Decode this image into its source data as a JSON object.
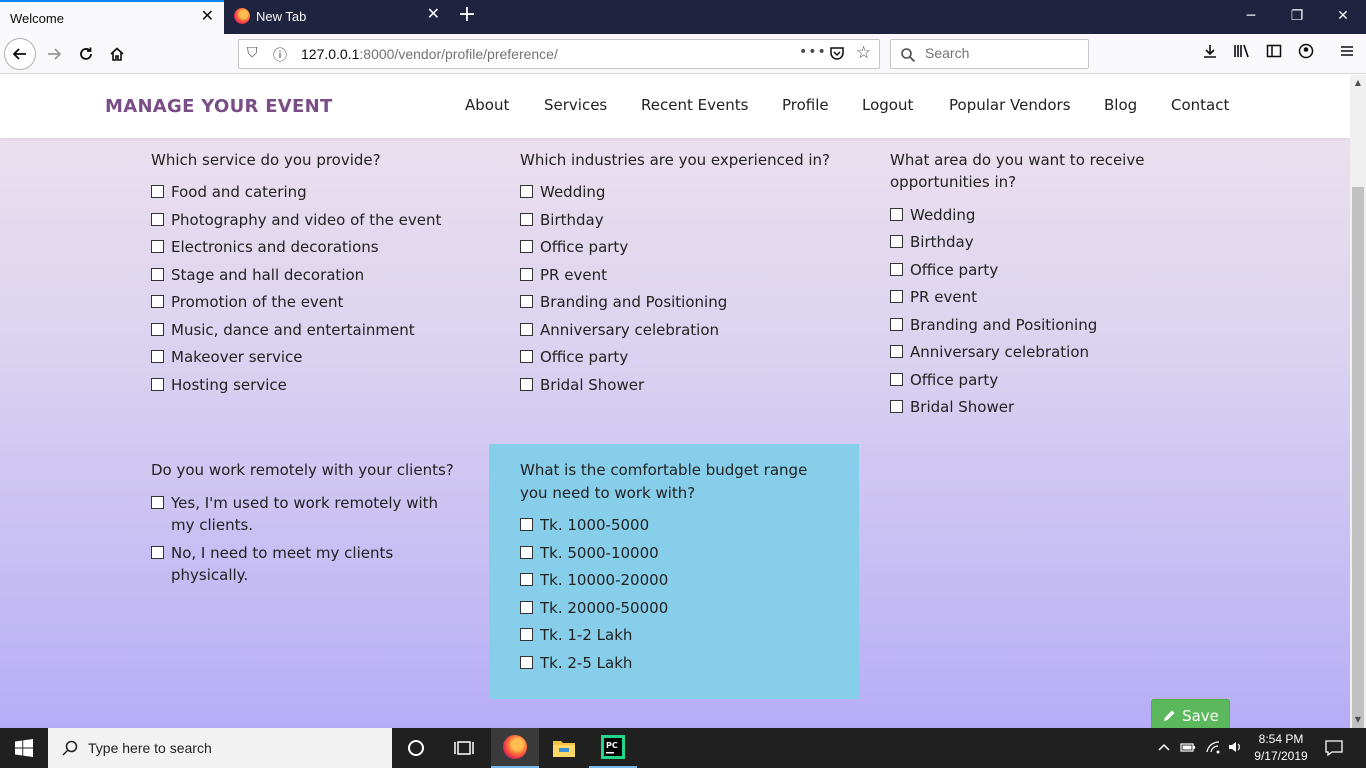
{
  "browser": {
    "tabs": [
      {
        "title": "Welcome",
        "active": true
      },
      {
        "title": "New Tab",
        "active": false
      }
    ],
    "url": {
      "host": "127.0.0.1",
      "rest": ":8000/vendor/profile/preference/"
    },
    "search_placeholder": "Search",
    "overflow_dots": "•••"
  },
  "site": {
    "brand": "MANAGE YOUR EVENT",
    "brand_color": "#7b4d86",
    "nav": [
      "About",
      "Services",
      "Recent Events",
      "Profile",
      "Logout",
      "Popular Vendors",
      "Blog",
      "Contact"
    ]
  },
  "form": {
    "services": {
      "title": "Which service do you provide?",
      "options": [
        "Food and catering",
        "Photography and video of the event",
        "Electronics and decorations",
        "Stage and hall decoration",
        "Promotion of the event",
        "Music, dance and entertainment",
        "Makeover service",
        "Hosting service"
      ]
    },
    "industries": {
      "title": "Which industries are you experienced in?",
      "options": [
        "Wedding",
        "Birthday",
        "Office party",
        "PR event",
        "Branding and Positioning",
        "Anniversary celebration",
        "Office party",
        "Bridal Shower"
      ]
    },
    "areas": {
      "title_line1": "What area do you want to receive",
      "title_line2": "opportunities in?",
      "options": [
        "Wedding",
        "Birthday",
        "Office party",
        "PR event",
        "Branding and Positioning",
        "Anniversary celebration",
        "Office party",
        "Bridal Shower"
      ]
    },
    "remote": {
      "title": "Do you work remotely with your clients?",
      "options": [
        {
          "line1": "Yes, I'm used to work remotely with",
          "line2": "my clients."
        },
        {
          "line1": "No, I need to meet my clients",
          "line2": "physically."
        }
      ]
    },
    "budget": {
      "title_line1": "What is the comfortable budget range",
      "title_line2": "you need to work with?",
      "options": [
        "Tk. 1000-5000",
        "Tk. 5000-10000",
        "Tk. 10000-20000",
        "Tk. 20000-50000",
        "Tk. 1-2 Lakh",
        "Tk. 2-5 Lakh"
      ],
      "panel_color": "#87ceeb"
    },
    "save_label": "Save",
    "save_color": "#5cb85c"
  },
  "taskbar": {
    "search_placeholder": "Type here to search",
    "time": "8:54 PM",
    "date": "9/17/2019"
  }
}
